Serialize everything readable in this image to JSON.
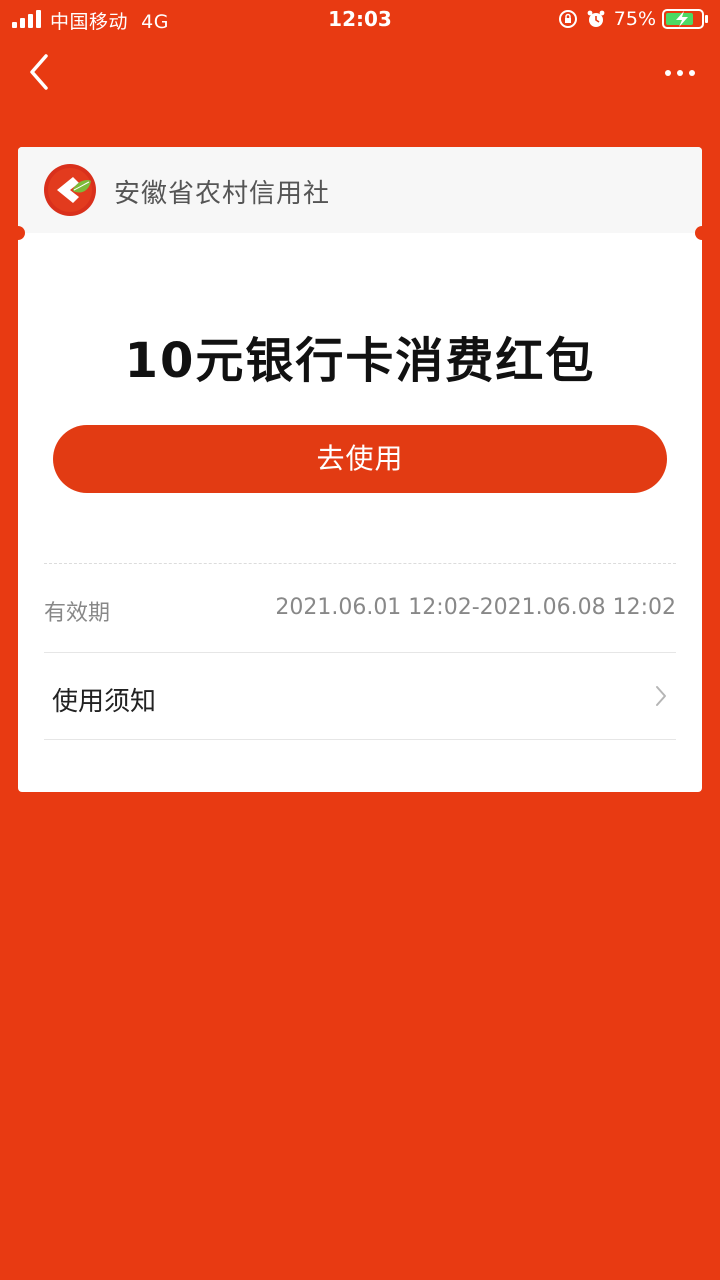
{
  "status_bar": {
    "carrier": "中国移动",
    "network": "4G",
    "time": "12:03",
    "battery": "75%",
    "icons": [
      "signal-icon",
      "rotation-lock-icon",
      "alarm-icon",
      "battery-charging-icon"
    ]
  },
  "nav": {
    "back_icon": "chevron-left-icon",
    "more_icon": "more-horizontal-icon"
  },
  "card": {
    "bank_name": "安徽省农村信用社",
    "coupon_title": "10元银行卡消费红包",
    "use_button": "去使用",
    "validity_label": "有效期",
    "validity_value": "2021.06.01 12:02-2021.06.08 12:02",
    "notice_label": "使用须知"
  },
  "colors": {
    "background": "#E83A12",
    "button": "#E23B13",
    "card": "#FFFFFF"
  }
}
